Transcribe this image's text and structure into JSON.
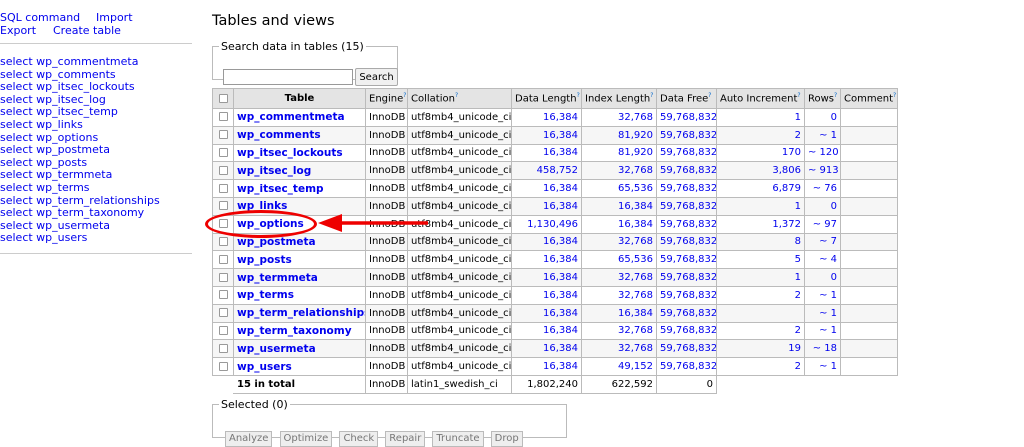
{
  "sidebar": {
    "sql_command": "SQL command",
    "import": "Import",
    "export": "Export",
    "create_table": "Create table",
    "tables": [
      "select wp_commentmeta",
      "select wp_comments",
      "select wp_itsec_lockouts",
      "select wp_itsec_log",
      "select wp_itsec_temp",
      "select wp_links",
      "select wp_options",
      "select wp_postmeta",
      "select wp_posts",
      "select wp_termmeta",
      "select wp_terms",
      "select wp_term_relationships",
      "select wp_term_taxonomy",
      "select wp_usermeta",
      "select wp_users"
    ]
  },
  "main": {
    "title": "Tables and views",
    "search": {
      "legend": "Search data in tables (15)",
      "value": "",
      "button": "Search"
    },
    "table": {
      "headers": [
        "Table",
        "Engine",
        "Collation",
        "Data Length",
        "Index Length",
        "Data Free",
        "Auto Increment",
        "Rows",
        "Comment"
      ],
      "help_mark": "?",
      "rows": [
        {
          "name": "wp_commentmeta",
          "engine": "InnoDB",
          "collation": "utf8mb4_unicode_ci",
          "data_length": "16,384",
          "index_length": "32,768",
          "data_free": "59,768,832",
          "auto_increment": "1",
          "rows": "0",
          "comment": ""
        },
        {
          "name": "wp_comments",
          "engine": "InnoDB",
          "collation": "utf8mb4_unicode_ci",
          "data_length": "16,384",
          "index_length": "81,920",
          "data_free": "59,768,832",
          "auto_increment": "2",
          "rows": "~ 1",
          "comment": ""
        },
        {
          "name": "wp_itsec_lockouts",
          "engine": "InnoDB",
          "collation": "utf8mb4_unicode_ci",
          "data_length": "16,384",
          "index_length": "81,920",
          "data_free": "59,768,832",
          "auto_increment": "170",
          "rows": "~ 120",
          "comment": ""
        },
        {
          "name": "wp_itsec_log",
          "engine": "InnoDB",
          "collation": "utf8mb4_unicode_ci",
          "data_length": "458,752",
          "index_length": "32,768",
          "data_free": "59,768,832",
          "auto_increment": "3,806",
          "rows": "~ 913",
          "comment": ""
        },
        {
          "name": "wp_itsec_temp",
          "engine": "InnoDB",
          "collation": "utf8mb4_unicode_ci",
          "data_length": "16,384",
          "index_length": "65,536",
          "data_free": "59,768,832",
          "auto_increment": "6,879",
          "rows": "~ 76",
          "comment": ""
        },
        {
          "name": "wp_links",
          "engine": "InnoDB",
          "collation": "utf8mb4_unicode_ci",
          "data_length": "16,384",
          "index_length": "16,384",
          "data_free": "59,768,832",
          "auto_increment": "1",
          "rows": "0",
          "comment": ""
        },
        {
          "name": "wp_options",
          "engine": "InnoDB",
          "collation": "utf8mb4_unicode_ci",
          "data_length": "1,130,496",
          "index_length": "16,384",
          "data_free": "59,768,832",
          "auto_increment": "1,372",
          "rows": "~ 97",
          "comment": ""
        },
        {
          "name": "wp_postmeta",
          "engine": "InnoDB",
          "collation": "utf8mb4_unicode_ci",
          "data_length": "16,384",
          "index_length": "32,768",
          "data_free": "59,768,832",
          "auto_increment": "8",
          "rows": "~ 7",
          "comment": ""
        },
        {
          "name": "wp_posts",
          "engine": "InnoDB",
          "collation": "utf8mb4_unicode_ci",
          "data_length": "16,384",
          "index_length": "65,536",
          "data_free": "59,768,832",
          "auto_increment": "5",
          "rows": "~ 4",
          "comment": ""
        },
        {
          "name": "wp_termmeta",
          "engine": "InnoDB",
          "collation": "utf8mb4_unicode_ci",
          "data_length": "16,384",
          "index_length": "32,768",
          "data_free": "59,768,832",
          "auto_increment": "1",
          "rows": "0",
          "comment": ""
        },
        {
          "name": "wp_terms",
          "engine": "InnoDB",
          "collation": "utf8mb4_unicode_ci",
          "data_length": "16,384",
          "index_length": "32,768",
          "data_free": "59,768,832",
          "auto_increment": "2",
          "rows": "~ 1",
          "comment": ""
        },
        {
          "name": "wp_term_relationships",
          "engine": "InnoDB",
          "collation": "utf8mb4_unicode_ci",
          "data_length": "16,384",
          "index_length": "16,384",
          "data_free": "59,768,832",
          "auto_increment": "",
          "rows": "~ 1",
          "comment": ""
        },
        {
          "name": "wp_term_taxonomy",
          "engine": "InnoDB",
          "collation": "utf8mb4_unicode_ci",
          "data_length": "16,384",
          "index_length": "32,768",
          "data_free": "59,768,832",
          "auto_increment": "2",
          "rows": "~ 1",
          "comment": ""
        },
        {
          "name": "wp_usermeta",
          "engine": "InnoDB",
          "collation": "utf8mb4_unicode_ci",
          "data_length": "16,384",
          "index_length": "32,768",
          "data_free": "59,768,832",
          "auto_increment": "19",
          "rows": "~ 18",
          "comment": ""
        },
        {
          "name": "wp_users",
          "engine": "InnoDB",
          "collation": "utf8mb4_unicode_ci",
          "data_length": "16,384",
          "index_length": "49,152",
          "data_free": "59,768,832",
          "auto_increment": "2",
          "rows": "~ 1",
          "comment": ""
        }
      ],
      "total": {
        "label": "15 in total",
        "engine": "InnoDB",
        "collation": "latin1_swedish_ci",
        "data_length": "1,802,240",
        "index_length": "622,592",
        "data_free": "0"
      }
    },
    "selected": {
      "legend": "Selected (0)",
      "buttons": [
        "Analyze",
        "Optimize",
        "Check",
        "Repair",
        "Truncate",
        "Drop"
      ]
    }
  },
  "colors": {
    "link": "#0000ee",
    "annotation": "#e00000",
    "header_bg": "#e4e4e4"
  }
}
